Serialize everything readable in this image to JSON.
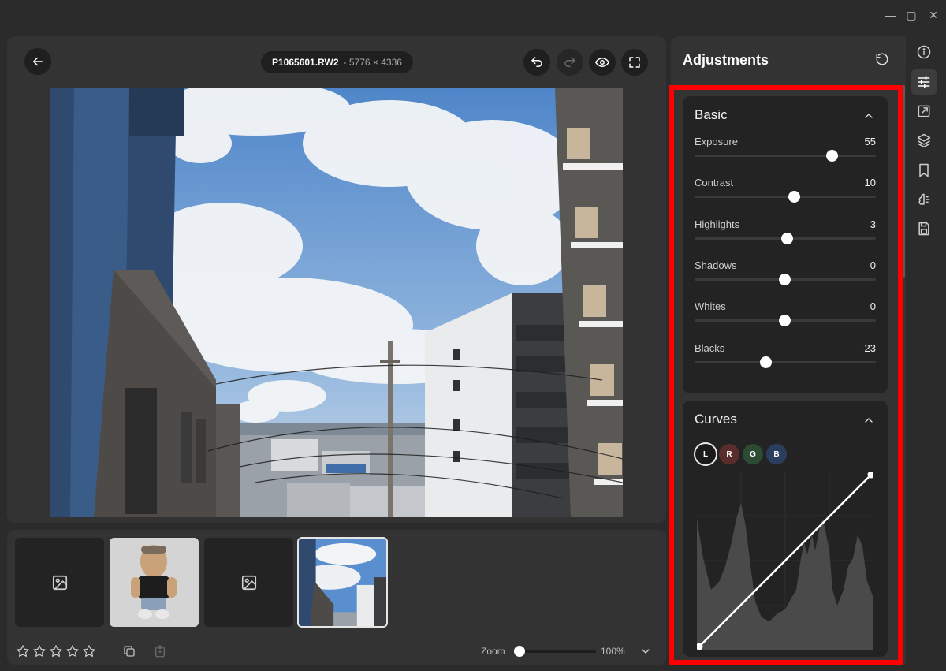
{
  "window": {
    "controls": [
      "minimize",
      "maximize",
      "close"
    ]
  },
  "viewer": {
    "file_name": "P1065601.RW2",
    "file_dims": "- 5776 × 4336"
  },
  "filmstrip": {
    "thumbnails": [
      {
        "type": "placeholder"
      },
      {
        "type": "doll-photo"
      },
      {
        "type": "placeholder"
      },
      {
        "type": "sky-photo",
        "selected": true
      }
    ],
    "rating_stars": 5,
    "zoom_label": "Zoom",
    "zoom_value": "100%",
    "zoom_level": 0.0
  },
  "panel": {
    "title": "Adjustments",
    "basic": {
      "title": "Basic",
      "sliders": [
        {
          "label": "Exposure",
          "value": "55",
          "position": 0.755
        },
        {
          "label": "Contrast",
          "value": "10",
          "position": 0.548
        },
        {
          "label": "Highlights",
          "value": "3",
          "position": 0.509
        },
        {
          "label": "Shadows",
          "value": "0",
          "position": 0.496
        },
        {
          "label": "Whites",
          "value": "0",
          "position": 0.496
        },
        {
          "label": "Blacks",
          "value": "-23",
          "position": 0.391
        }
      ]
    },
    "curves": {
      "title": "Curves",
      "channels": [
        "L",
        "R",
        "G",
        "B"
      ],
      "active_channel": "L"
    }
  },
  "rail": {
    "icons": [
      "info-icon",
      "adjustments-icon",
      "export-icon",
      "layers-icon",
      "bookmark-icon",
      "ai-brain-icon",
      "save-icon"
    ],
    "active": "adjustments-icon"
  },
  "colors": {
    "highlight_border": "#ff0000",
    "panel_bg": "#333333",
    "card_bg": "#232323"
  }
}
